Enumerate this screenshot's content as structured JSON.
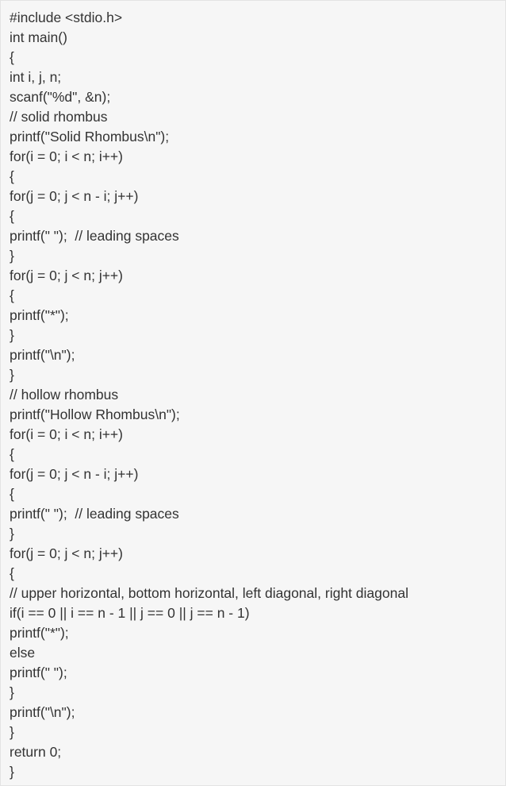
{
  "code": {
    "lines": [
      "#include <stdio.h>",
      "int main()",
      "{",
      "int i, j, n;",
      "scanf(\"%d\", &n);",
      "// solid rhombus",
      "printf(\"Solid Rhombus\\n\");",
      "for(i = 0; i < n; i++)",
      "{",
      "for(j = 0; j < n - i; j++)",
      "{",
      "printf(\" \");  // leading spaces",
      "}",
      "for(j = 0; j < n; j++)",
      "{",
      "printf(\"*\");",
      "}",
      "printf(\"\\n\");",
      "}",
      "// hollow rhombus",
      "printf(\"Hollow Rhombus\\n\");",
      "for(i = 0; i < n; i++)",
      "{",
      "for(j = 0; j < n - i; j++)",
      "{",
      "printf(\" \");  // leading spaces",
      "}",
      "for(j = 0; j < n; j++)",
      "{",
      "// upper horizontal, bottom horizontal, left diagonal, right diagonal",
      "if(i == 0 || i == n - 1 || j == 0 || j == n - 1)",
      "printf(\"*\");",
      "else",
      "printf(\" \");",
      "}",
      "printf(\"\\n\");",
      "}",
      "return 0;",
      "}"
    ]
  }
}
